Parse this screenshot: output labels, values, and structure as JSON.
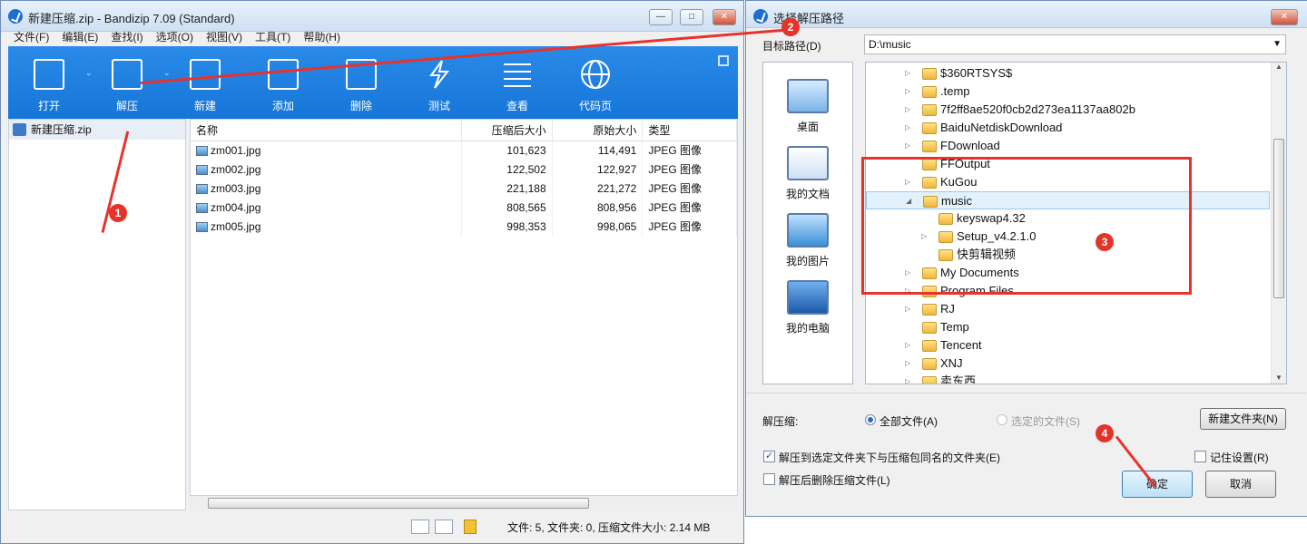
{
  "main_window": {
    "title": "新建压缩.zip - Bandizip 7.09 (Standard)",
    "menu": [
      "文件(F)",
      "编辑(E)",
      "查找(I)",
      "选项(O)",
      "视图(V)",
      "工具(T)",
      "帮助(H)"
    ],
    "toolbar": [
      {
        "label": "打开",
        "icon": "open-icon",
        "dropdown": true
      },
      {
        "label": "解压",
        "icon": "extract-icon",
        "dropdown": true
      },
      {
        "label": "新建",
        "icon": "new-archive-icon",
        "dropdown": false
      },
      {
        "label": "添加",
        "icon": "add-file-icon",
        "dropdown": false
      },
      {
        "label": "删除",
        "icon": "delete-file-icon",
        "dropdown": false
      },
      {
        "label": "测试",
        "icon": "test-icon",
        "dropdown": false
      },
      {
        "label": "查看",
        "icon": "view-icon",
        "dropdown": false
      },
      {
        "label": "代码页",
        "icon": "codepage-globe-icon",
        "dropdown": false
      }
    ],
    "tree_item": "新建压缩.zip",
    "columns": [
      "名称",
      "压缩后大小",
      "原始大小",
      "类型"
    ],
    "files": [
      {
        "name": "zm001.jpg",
        "compressed": "101,623",
        "original": "114,491",
        "type": "JPEG 图像"
      },
      {
        "name": "zm002.jpg",
        "compressed": "122,502",
        "original": "122,927",
        "type": "JPEG 图像"
      },
      {
        "name": "zm003.jpg",
        "compressed": "221,188",
        "original": "221,272",
        "type": "JPEG 图像"
      },
      {
        "name": "zm004.jpg",
        "compressed": "808,565",
        "original": "808,956",
        "type": "JPEG 图像"
      },
      {
        "name": "zm005.jpg",
        "compressed": "998,353",
        "original": "998,065",
        "type": "JPEG 图像"
      }
    ],
    "status": "文件: 5, 文件夹: 0, 压缩文件大小: 2.14 MB"
  },
  "dialog": {
    "title": "选择解压路径",
    "target_label": "目标路径(D)",
    "target_value": "D:\\music",
    "places": [
      "桌面",
      "我的文档",
      "我的图片",
      "我的电脑"
    ],
    "tree": [
      {
        "name": "$360RTSYS$",
        "level": 0,
        "expandable": true
      },
      {
        "name": ".temp",
        "level": 0,
        "expandable": true
      },
      {
        "name": "7f2ff8ae520f0cb2d273ea1137aa802b",
        "level": 0,
        "expandable": true
      },
      {
        "name": "BaiduNetdiskDownload",
        "level": 0,
        "expandable": true
      },
      {
        "name": "FDownload",
        "level": 0,
        "expandable": true
      },
      {
        "name": "FFOutput",
        "level": 0,
        "expandable": false
      },
      {
        "name": "KuGou",
        "level": 0,
        "expandable": true
      },
      {
        "name": "music",
        "level": 0,
        "expandable": true,
        "expanded": true,
        "selected": true
      },
      {
        "name": "keyswap4.32",
        "level": 1,
        "expandable": false
      },
      {
        "name": "Setup_v4.2.1.0",
        "level": 1,
        "expandable": true
      },
      {
        "name": "快剪辑视频",
        "level": 1,
        "expandable": false
      },
      {
        "name": "My Documents",
        "level": 0,
        "expandable": true
      },
      {
        "name": "Program Files",
        "level": 0,
        "expandable": true
      },
      {
        "name": "RJ",
        "level": 0,
        "expandable": true
      },
      {
        "name": "Temp",
        "level": 0,
        "expandable": false
      },
      {
        "name": "Tencent",
        "level": 0,
        "expandable": true
      },
      {
        "name": "XNJ",
        "level": 0,
        "expandable": true
      },
      {
        "name": "卖东西",
        "level": 0,
        "expandable": true
      }
    ],
    "extract_label": "解压缩:",
    "radio_all": "全部文件(A)",
    "radio_selected": "选定的文件(S)",
    "new_folder": "新建文件夹(N)",
    "check_subfolder": "解压到选定文件夹下与压缩包同名的文件夹(E)",
    "check_subfolder_checked": true,
    "check_delete": "解压后删除压缩文件(L)",
    "check_delete_checked": false,
    "check_remember": "记住设置(R)",
    "check_remember_checked": false,
    "ok": "确定",
    "cancel": "取消"
  },
  "annotations": [
    "1",
    "2",
    "3",
    "4"
  ],
  "colors": {
    "toolbar": "#1576d8",
    "annotation": "#e8322d"
  }
}
